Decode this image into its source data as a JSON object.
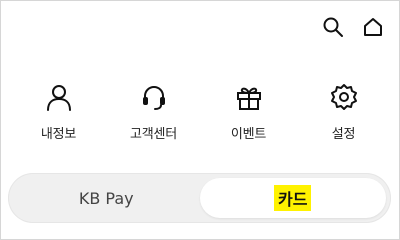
{
  "header": {
    "icons": [
      "search-icon",
      "home-icon"
    ]
  },
  "quick_menu": {
    "items": [
      {
        "label": "내정보",
        "icon": "person-icon"
      },
      {
        "label": "고객센터",
        "icon": "headset-icon"
      },
      {
        "label": "이벤트",
        "icon": "gift-icon"
      },
      {
        "label": "설정",
        "icon": "gear-icon"
      }
    ]
  },
  "tabs": {
    "items": [
      {
        "label": "KB Pay",
        "active": false
      },
      {
        "label": "카드",
        "active": true,
        "highlighted": true
      }
    ]
  },
  "colors": {
    "highlight": "#fff200",
    "tab_track": "#f0f0f0",
    "tab_active": "#ffffff"
  }
}
